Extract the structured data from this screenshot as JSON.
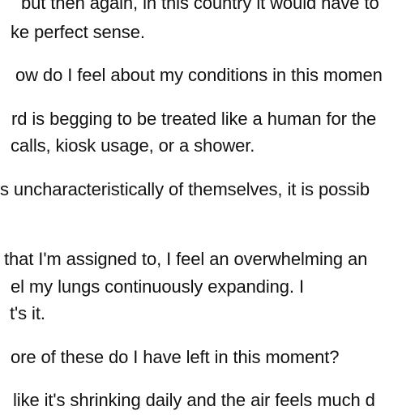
{
  "document": {
    "lines": [
      "but then again, in this country it would have to",
      "ke perfect sense.",
      "ow do I feel about my conditions in this momen",
      "rd is begging to be treated like a human for the",
      "calls, kiosk usage, or a shower.",
      "s uncharacteristically of themselves, it is possib",
      "that I'm assigned to, I feel an overwhelming an",
      "el my lungs continuously expanding. I",
      "t's it.",
      "ore of these do I have left in this moment?",
      "like it's shrinking daily and the air feels much d"
    ]
  }
}
